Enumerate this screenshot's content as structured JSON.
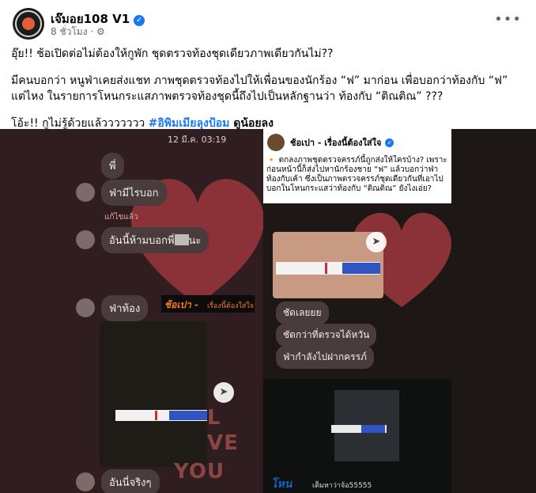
{
  "post": {
    "page_name": "เจ๊มอย108 V1",
    "time": "8 ชั่วโมง",
    "more_icon": "more-horizontal-icon",
    "text": {
      "line1": "อุ๊ย!! ช้อเปิดต่อไม่ต้องให้กูพัก  ชุดตรวจท้องชุดเดียวภาพเดียวกันไม่??",
      "line2": "มีคนบอกว่า หนูฟ่าเคยส่งแชท ภาพชุดตรวจท้องไปให้เพื่อนของนักร้อง “ฟ” มาก่อน เพื่อบอกว่าท้องกับ “ฟ”",
      "line3": "แต่ไหง ในรายการโหนกระแสภาพตรวจท้องชุดนี้ถึงไปเป็นหลักฐานว่า ท้องกับ “ติณติณ”  ???",
      "line4_prefix": "โอ้ะ!!  กูไม่รู้ด้วยแล้ววววววว ",
      "hashtag": "#อิพิมเมียลุงป้อม",
      "line4_suffix": " ดูน้อยลง"
    }
  },
  "image": {
    "left": {
      "timestamp": "12 มี.ค. 03:19",
      "bubbles": [
        "พี่",
        "ฟ่ามีไรบอก",
        "อันนี้ห้ามบอกพี่",
        "ฟ่าท้อง",
        "อันนี่จริงๆ"
      ],
      "edit_note": "แก้ไขแล้ว",
      "bubble_suffix": "นะ",
      "brand": "ช้อเปา -",
      "brand_sub": "เรื่องนี้ต้องใส่ใจ",
      "love_text": [
        "L",
        "VE",
        "YOU"
      ]
    },
    "right": {
      "card_name": "ช้อเปา - เรื่องนี้ต้องใส่ใจ",
      "card_text": "🔸 ตกลงภาพชุดตรวจครรภ์นี้ถูกส่งให้ใครบ้าง? เพราะก่อนหน้านี้ก็ส่งไปหานักร้องชาย “ฟ” แล้วบอกว่าฟ่าท้องกับเค้า ซึ่งเป็นภาพตรวจครรภ์ชุดเดียวกันที่เอาไปบอกในโหนกระแสว่าท้องกับ “ติณติณ” ยังไงเอ่ย?",
      "bubbles": [
        "ชัดเลยยย",
        "ชัดกว่าที่ตรวจได้หวัน",
        "ฟ่ากำลังไปฝากครรภ์"
      ],
      "video_logo": "โหน",
      "video_caption": "เต็มหาว่าจ้อ55555"
    }
  }
}
